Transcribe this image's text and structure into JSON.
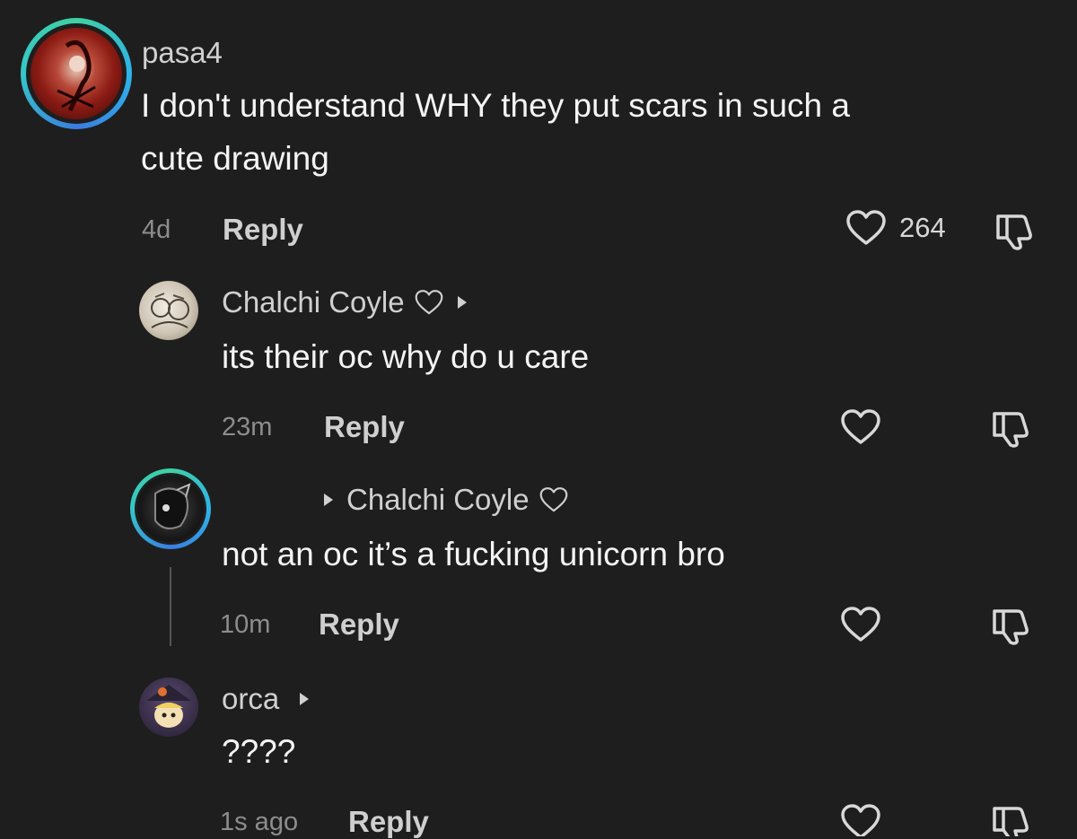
{
  "comments": [
    {
      "username": "pasa4",
      "text_line1": "I don't understand WHY they put scars in such a",
      "text_line2": "cute drawing",
      "time": "4d",
      "reply_label": "Reply",
      "likes": "264"
    },
    {
      "username": "Chalchi Coyle",
      "text": "its their oc why do u care",
      "time": "23m",
      "reply_label": "Reply"
    },
    {
      "reply_to": "Chalchi Coyle",
      "text": "not an oc it’s a fucking unicorn bro",
      "time": "10m",
      "reply_label": "Reply"
    },
    {
      "username": "orca",
      "text": "????",
      "time": "1s ago",
      "reply_label": "Reply"
    }
  ],
  "colors": {
    "background": "#1e1e1e",
    "ring_gradient": [
      "#3fd1a3",
      "#2fb3e8",
      "#3a7de0"
    ]
  },
  "icons": [
    "heart-outline-icon",
    "thumbs-down-icon",
    "caret-right-icon",
    "small-heart-icon"
  ]
}
